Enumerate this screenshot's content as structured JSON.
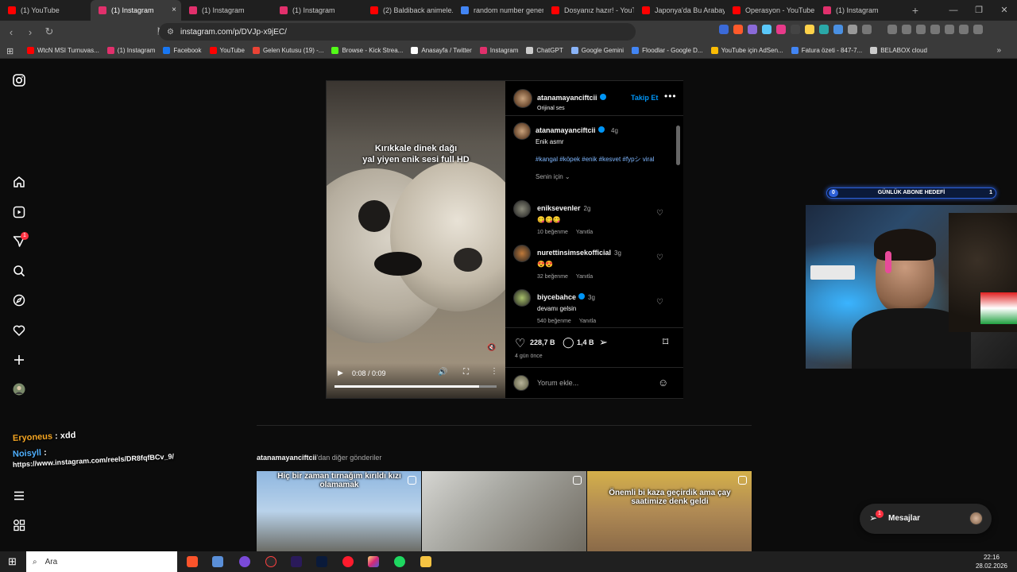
{
  "tabs": [
    {
      "label": "(1) YouTube",
      "color": "#ff0000"
    },
    {
      "label": "(1) Instagram",
      "color": "#e1306c",
      "active": true
    },
    {
      "label": "(1) Instagram",
      "color": "#e1306c"
    },
    {
      "label": "(1) Instagram",
      "color": "#e1306c"
    },
    {
      "label": "(2) Baldiback animele...",
      "color": "#ff0000"
    },
    {
      "label": "random number gener...",
      "color": "#4285f4"
    },
    {
      "label": "Dosyanız hazır! - YouTu...",
      "color": "#ff0000"
    },
    {
      "label": "Japonya'da Bu Arabay...",
      "color": "#ff0000"
    },
    {
      "label": "Operasyon - YouTube",
      "color": "#ff0000"
    },
    {
      "label": "(1) Instagram",
      "color": "#e1306c"
    }
  ],
  "tab_close": "×",
  "new_tab": "+",
  "window_controls": {
    "minimize": "—",
    "maximize": "❐",
    "close": "✕"
  },
  "address": {
    "url": "instagram.com/p/DVJp-x9jEC/"
  },
  "bookmarks": [
    {
      "label": "WtcN MSI Turnuvas...",
      "color": "#ff0000"
    },
    {
      "label": "(1) Instagram",
      "color": "#e1306c"
    },
    {
      "label": "Facebook",
      "color": "#1877f2"
    },
    {
      "label": "YouTube",
      "color": "#ff0000"
    },
    {
      "label": "Gelen Kutusu (19) -...",
      "color": "#ea4335"
    },
    {
      "label": "Browse - Kick Strea...",
      "color": "#53fc18"
    },
    {
      "label": "Anasayfa / Twitter",
      "color": "#ffffff"
    },
    {
      "label": "Instagram",
      "color": "#e1306c"
    },
    {
      "label": "ChatGPT",
      "color": "#cccccc"
    },
    {
      "label": "Google Gemini",
      "color": "#8ab4f8"
    },
    {
      "label": "Floodlar - Google D...",
      "color": "#4285f4"
    },
    {
      "label": "YouTube için AdSen...",
      "color": "#fbbc04"
    },
    {
      "label": "Fatura özeti - 847-7...",
      "color": "#4285f4"
    },
    {
      "label": "BELABOX cloud",
      "color": "#cccccc"
    }
  ],
  "sidebar": {
    "notification_count": "1"
  },
  "video": {
    "caption_line1": "Kırıkkale dinek dağı",
    "caption_line2": "yal yiyen enik sesi full HD",
    "time": "0:08 / 0:09",
    "progress": 0.89
  },
  "post": {
    "author": "atanamayanciftcii",
    "audio": "Orijinal ses",
    "follow_label": "Takip Et",
    "caption_age": "4g",
    "caption_text": "Enik asmr",
    "hashtags": "#kangal #köpek #enik #kesvet #fypシ viral",
    "sort_label": "Senin için",
    "likes": "228,7 B",
    "comments_count": "1,4 B",
    "posted": "4 gün önce",
    "add_comment_placeholder": "Yorum ekle..."
  },
  "comments": [
    {
      "user": "eniksevenler",
      "age": "2g",
      "text": "😋😋😋",
      "likes": "10 beğenme",
      "reply": "Yanıtla",
      "verified": false
    },
    {
      "user": "nurettinsimsekofficial",
      "age": "3g",
      "text": "😍😍",
      "likes": "32 beğenme",
      "reply": "Yanıtla",
      "verified": false
    },
    {
      "user": "biycebahce",
      "age": "3g",
      "text": "devamı gelsin",
      "likes": "540 beğenme",
      "reply": "Yanıtla",
      "verified": true
    }
  ],
  "more_posts": {
    "user": "atanamayanciftcii",
    "suffix": "'dan diğer gönderiler",
    "items": [
      {
        "caption": "Hiç bir zaman tırnağım kırıldı kızı olamamak"
      },
      {
        "caption": ""
      },
      {
        "caption": "Önemli bi kaza geçirdik ama çay saatimize denk geldi"
      }
    ]
  },
  "overlay": {
    "goal_label": "GÜNLÜK ABONE HEDEFİ",
    "goal_current": "0",
    "goal_target": "1",
    "chat": [
      {
        "user": "Eryoneus",
        "message": "xdd"
      },
      {
        "user": "Noisyll",
        "message": "https://www.instagram.com/reels/DR8fqfBCv_9/"
      }
    ]
  },
  "messages_label": "Mesajlar",
  "taskbar": {
    "search_placeholder": "Ara",
    "time": "22:16",
    "date": "28.02.2026"
  }
}
